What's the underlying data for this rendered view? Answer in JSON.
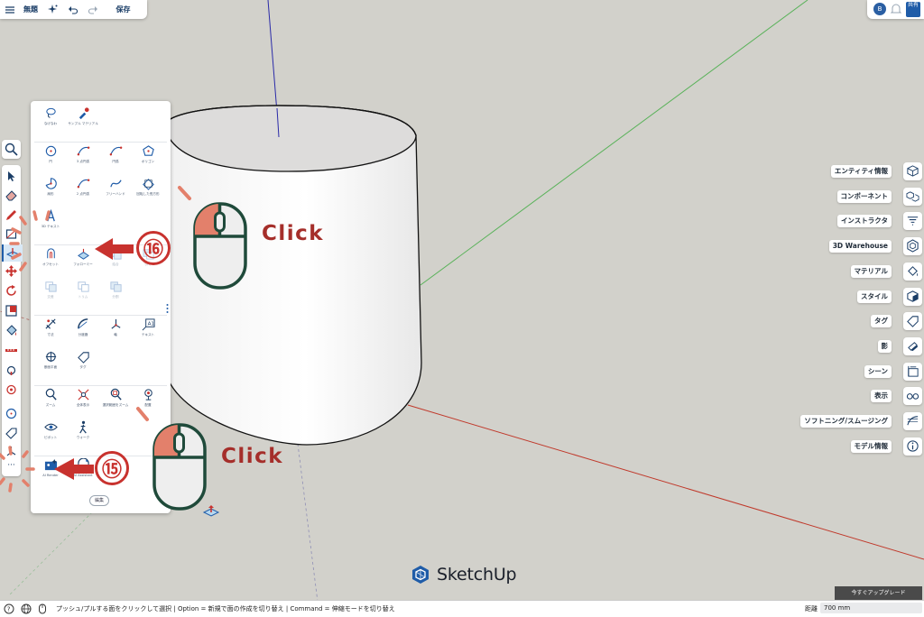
{
  "topbar": {
    "title": "無題",
    "save_label": "保存"
  },
  "topright": {
    "user_initial": "B",
    "share_label": "共有"
  },
  "panel": {
    "sections": [
      [
        {
          "name": "lasso-tool",
          "label": "なげなわ",
          "icon": "lasso-icon"
        },
        {
          "name": "sample-material-tool",
          "label": "サンプル マテリアル",
          "icon": "eyedropper-icon"
        }
      ],
      [
        {
          "name": "circle-tool",
          "label": "円",
          "icon": "circle-icon"
        },
        {
          "name": "arc-3point-tool",
          "label": "3 点円弧",
          "icon": "arc-icon"
        },
        {
          "name": "arc-tool",
          "label": "円弧",
          "icon": "arc-icon"
        },
        {
          "name": "polygon-tool",
          "label": "ポリゴン",
          "icon": "polygon-icon"
        },
        {
          "name": "pie-tool",
          "label": "扇形",
          "icon": "pie-icon"
        },
        {
          "name": "2point-arc-tool",
          "label": "2 点円弧",
          "icon": "arc-icon"
        },
        {
          "name": "freehand-tool",
          "label": "フリーハンド",
          "icon": "freehand-icon"
        },
        {
          "name": "rotated-rectangle-tool",
          "label": "回転した長方形",
          "icon": "rotated-rectangle-icon"
        },
        {
          "name": "3d-text-tool",
          "label": "3D テキスト",
          "icon": "3d-text-icon"
        }
      ],
      [
        {
          "name": "offset-tool",
          "label": "オフセット",
          "icon": "offset-icon"
        },
        {
          "name": "followme-tool",
          "label": "フォローミー",
          "icon": "followme-icon"
        },
        {
          "name": "union-tool",
          "label": "結合",
          "icon": "union-icon",
          "disabled": true
        },
        {
          "name": "subtract-tool",
          "label": "引く",
          "icon": "subtract-icon",
          "disabled": true
        },
        {
          "name": "trim-tool",
          "label": "交差",
          "icon": "trim-icon",
          "disabled": true
        },
        {
          "name": "split-tool",
          "label": "トリム",
          "icon": "split-icon",
          "disabled": true
        },
        {
          "name": "outer-shell-tool",
          "label": "分割",
          "icon": "outer-shell-icon",
          "disabled": true
        }
      ],
      [
        {
          "name": "dimension-tool",
          "label": "寸法",
          "icon": "dimension-icon"
        },
        {
          "name": "protractor-tool",
          "label": "分度器",
          "icon": "protractor-icon"
        },
        {
          "name": "axes-tool",
          "label": "軸",
          "icon": "axes-icon"
        },
        {
          "name": "text-tool",
          "label": "テキスト",
          "icon": "text-icon"
        },
        {
          "name": "section-plane-tool",
          "label": "断面平面",
          "icon": "section-plane-icon"
        },
        {
          "name": "tag-tool",
          "label": "タグ",
          "icon": "tag-icon"
        }
      ],
      [
        {
          "name": "zoom-tool",
          "label": "ズーム",
          "icon": "zoom-icon"
        },
        {
          "name": "zoom-extents-tool",
          "label": "全体表示",
          "icon": "zoom-extents-icon"
        },
        {
          "name": "zoom-selection-tool",
          "label": "選択範囲をズーム",
          "icon": "zoom-selection-icon"
        },
        {
          "name": "position-camera-tool",
          "label": "配置",
          "icon": "position-camera-icon"
        },
        {
          "name": "look-around-tool",
          "label": "ピボット",
          "icon": "look-around-icon"
        },
        {
          "name": "walk-tool",
          "label": "ウォーク",
          "icon": "walk-icon"
        }
      ],
      [
        {
          "name": "ai-render-tool",
          "label": "AI Render",
          "icon": "ai-render-icon"
        },
        {
          "name": "ai-assistant-tool",
          "label": "AI Assistant",
          "icon": "ai-assistant-icon"
        }
      ]
    ],
    "edit_label": "編集"
  },
  "right_panels": [
    {
      "name": "entity-info",
      "label": "エンティティ情報",
      "icon": "cube-icon"
    },
    {
      "name": "components",
      "label": "コンポーネント",
      "icon": "components-icon"
    },
    {
      "name": "instructor",
      "label": "インストラクタ",
      "icon": "instructor-icon"
    },
    {
      "name": "3d-warehouse",
      "label": "3D Warehouse",
      "icon": "warehouse-icon"
    },
    {
      "name": "materials",
      "label": "マテリアル",
      "icon": "materials-icon"
    },
    {
      "name": "styles",
      "label": "スタイル",
      "icon": "styles-icon"
    },
    {
      "name": "tags",
      "label": "タグ",
      "icon": "tag-icon"
    },
    {
      "name": "shadows",
      "label": "影",
      "icon": "shadow-icon"
    },
    {
      "name": "scenes",
      "label": "シーン",
      "icon": "scenes-icon"
    },
    {
      "name": "display",
      "label": "表示",
      "icon": "glasses-icon"
    },
    {
      "name": "soften-smooth",
      "label": "ソフトニング/スムージング",
      "icon": "soften-icon"
    },
    {
      "name": "model-info",
      "label": "モデル情報",
      "icon": "info-icon"
    }
  ],
  "upgrade_label": "今すぐアップグレード",
  "status": {
    "text": "プッシュ/プルする面をクリックして選択 | Option = 新規で面の作成を切り替え | Command = 伸縮モードを切り替え",
    "measure_label": "距離",
    "measure_value": "700 mm"
  },
  "logo": {
    "text": "SketchUp"
  },
  "annotations": {
    "click_label": "Click",
    "step_16": "⑯",
    "step_15": "⑮"
  },
  "colors": {
    "accent": "#1f5ca8",
    "annotation_red": "#c8322e",
    "mouse_green": "#1f4a3a",
    "mouse_salmon": "#e3806b",
    "axis_blue": "#2233aa",
    "axis_green": "#4cb14c",
    "axis_red": "#c0392b",
    "background": "#d2d1cb"
  }
}
